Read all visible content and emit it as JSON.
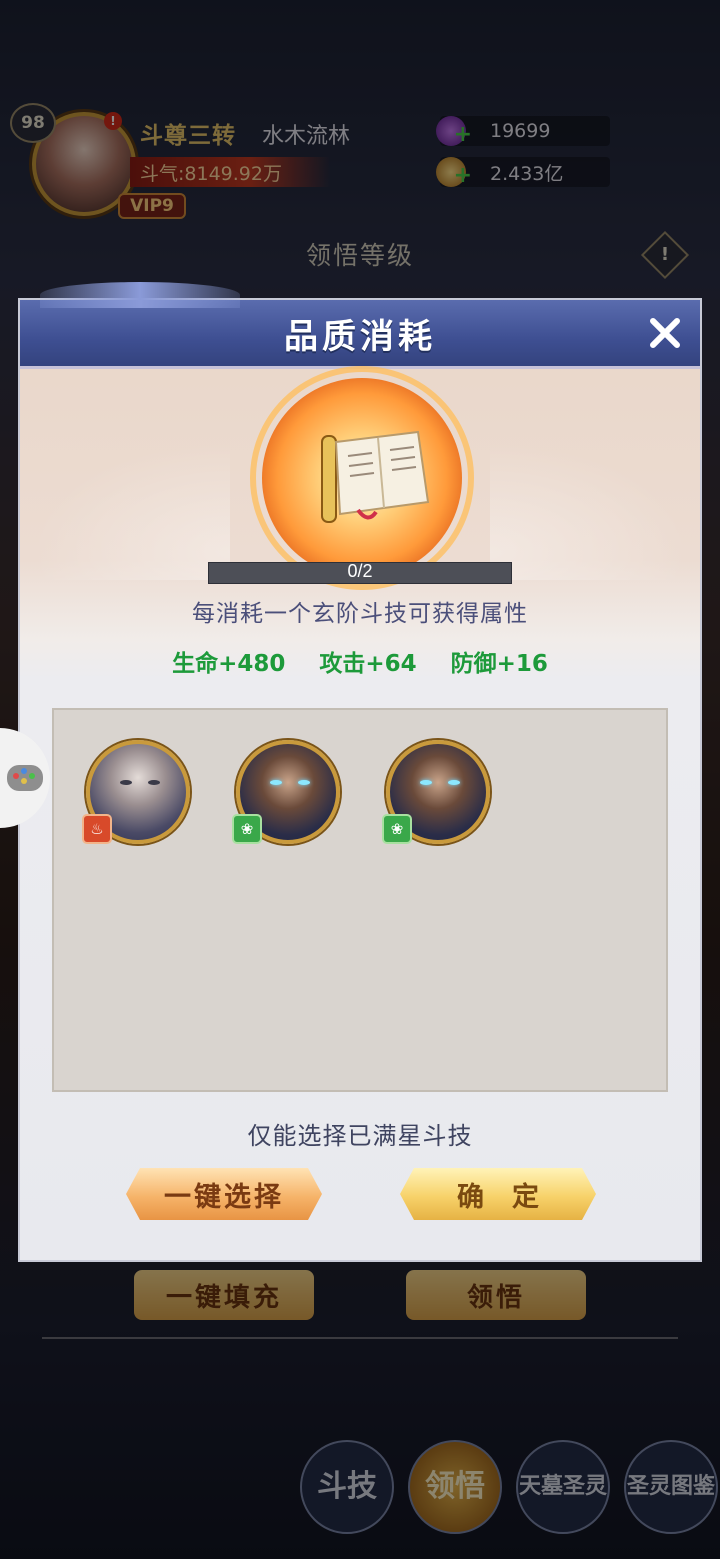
{
  "player": {
    "level": "98",
    "rank": "斗尊三转",
    "name": "水木流林",
    "power": "斗气:8149.92万",
    "vip": "VIP9",
    "notice": "!"
  },
  "resources": [
    {
      "icon": "purple-gem-icon",
      "value": "19699",
      "color": "#8a3ac8"
    },
    {
      "icon": "gold-coin-icon",
      "value": "2.433亿",
      "color": "#d6a43a"
    }
  ],
  "section_title": "领悟等级",
  "modal": {
    "title": "品质消耗",
    "progress": {
      "text": "0/2",
      "current": 0,
      "max": 2
    },
    "description": "每消耗一个玄阶斗技可获得属性",
    "stats": [
      "生命+480",
      "攻击+64",
      "防御+16"
    ],
    "heroes": [
      {
        "name": "hero-white-haired-elder",
        "faction": "fire"
      },
      {
        "name": "hero-dark-armored-warrior",
        "faction": "wood"
      },
      {
        "name": "hero-dark-armored-warrior",
        "faction": "wood"
      }
    ],
    "hint": "仅能选择已满星斗技",
    "select_all_label": "一键选择",
    "confirm_label": "确定"
  },
  "background_buttons": {
    "fill_label": "一键填充",
    "comprehend_label": "领悟"
  },
  "bottom_nav": [
    {
      "label": "斗技",
      "active": false
    },
    {
      "label": "领悟",
      "active": true,
      "badge": "!"
    },
    {
      "label": "天墓圣灵",
      "active": false
    },
    {
      "label": "圣灵图鉴",
      "active": false
    }
  ]
}
